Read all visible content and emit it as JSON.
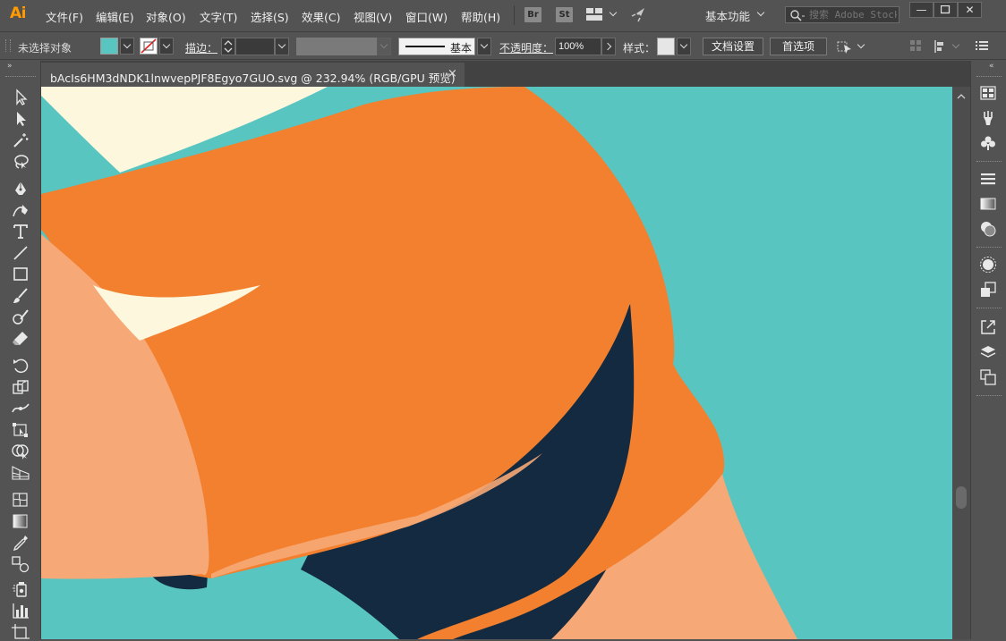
{
  "app": {
    "logo": "Ai"
  },
  "menubar": {
    "items": [
      "文件(F)",
      "编辑(E)",
      "对象(O)",
      "文字(T)",
      "选择(S)",
      "效果(C)",
      "视图(V)",
      "窗口(W)",
      "帮助(H)"
    ],
    "bridge_label": "Br",
    "stock_label": "St",
    "workspace": "基本功能",
    "search_placeholder": "搜索 Adobe Stock"
  },
  "controlbar": {
    "selection_status": "未选择对象",
    "fill_color": "#58c5c1",
    "stroke_label": "描边：",
    "stroke_profile": "基本",
    "opacity_label": "不透明度：",
    "opacity_value": "100%",
    "style_label": "样式：",
    "doc_setup_label": "文档设置",
    "preferences_label": "首选项"
  },
  "document": {
    "tab_title": "bAcIs6HM3dNDK1lnwvepPJF8Egyo7GUO.svg  @  232.94%  (RGB/GPU 预览)",
    "close_glyph": "×",
    "zoom": "232.94%",
    "colors": {
      "background": "#58c5c1",
      "orange": "#f2802f",
      "cream": "#fdf7de",
      "peach": "#f7a877",
      "navy": "#132a40"
    }
  },
  "tools": [
    "selection-tool",
    "direct-selection-tool",
    "magic-wand-tool",
    "lasso-tool",
    "pen-tool",
    "curvature-tool",
    "type-tool",
    "line-segment-tool",
    "rectangle-tool",
    "paintbrush-tool",
    "shaper-tool",
    "eraser-tool",
    "rotate-tool",
    "scale-tool",
    "width-tool",
    "free-transform-tool",
    "shape-builder-tool",
    "perspective-grid-tool",
    "mesh-tool",
    "gradient-tool",
    "eyedropper-tool",
    "blend-tool",
    "symbol-sprayer-tool",
    "column-graph-tool",
    "artboard-tool"
  ],
  "dock": [
    "swatches-icon",
    "brushes-icon",
    "symbols-icon",
    "stroke-icon",
    "gradient-icon",
    "transparency-icon",
    "appearance-icon",
    "graphic-styles-icon",
    "export-icon",
    "layers-icon",
    "artboards-icon"
  ]
}
